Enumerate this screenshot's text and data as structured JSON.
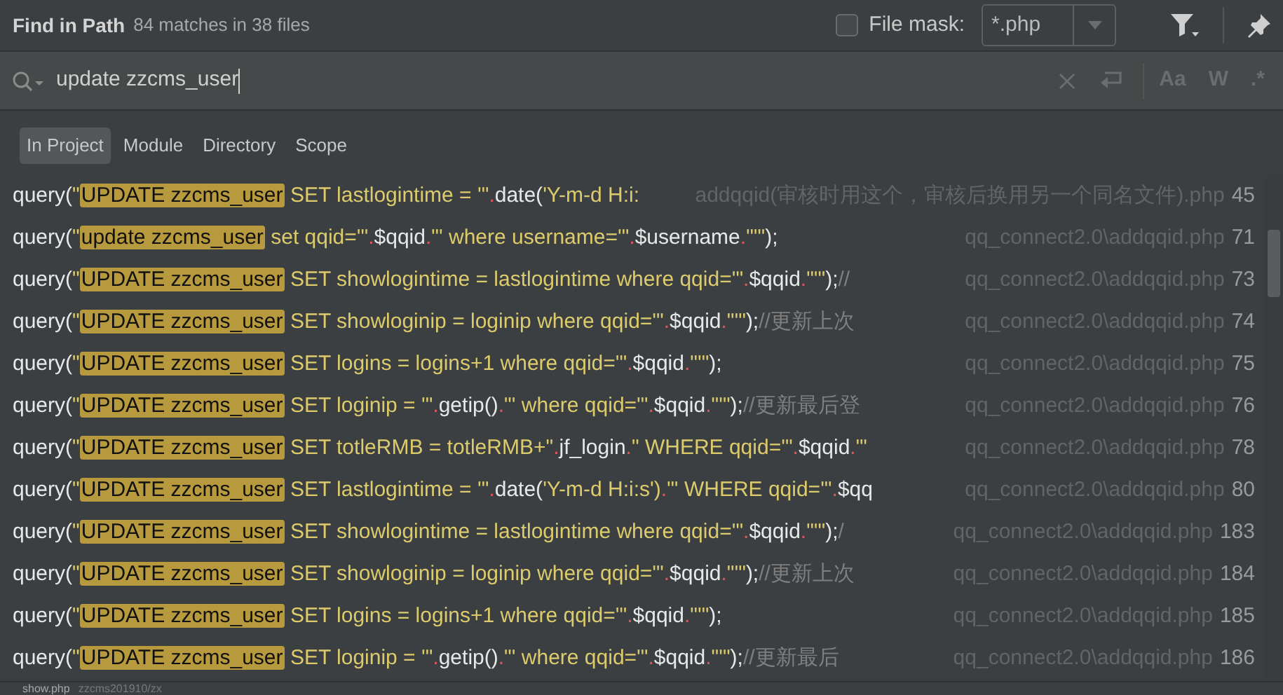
{
  "header": {
    "title": "Find in Path",
    "summary": "84 matches in 38 files",
    "file_mask": {
      "label": "File mask:",
      "checked": false,
      "value": "*.php"
    }
  },
  "search": {
    "value": "update zzcms_user",
    "toggles": [
      {
        "label": "Aa",
        "selected": false
      },
      {
        "label": "W",
        "selected": false
      },
      {
        "label": ".*",
        "selected": false
      }
    ]
  },
  "scopes": [
    {
      "label": "In Project",
      "selected": true
    },
    {
      "label": "Module",
      "selected": false
    },
    {
      "label": "Directory",
      "selected": false
    },
    {
      "label": "Scope",
      "selected": false
    }
  ],
  "results": [
    {
      "code": [
        {
          "kind": "fn",
          "text": "query("
        },
        {
          "kind": "str",
          "text": "\""
        },
        {
          "kind": "match",
          "text": "UPDATE zzcms_user"
        },
        {
          "kind": "str",
          "text": " SET lastlogintime = '\""
        },
        {
          "kind": "op",
          "text": "."
        },
        {
          "kind": "fn",
          "text": "date("
        },
        {
          "kind": "str",
          "text": "'Y-m-d H:i:"
        }
      ],
      "file": "addqqid(审核时用这个，审核后换用另一个同名文件).php",
      "line": "45"
    },
    {
      "code": [
        {
          "kind": "fn",
          "text": "query("
        },
        {
          "kind": "str",
          "text": "\""
        },
        {
          "kind": "match",
          "text": "update zzcms_user"
        },
        {
          "kind": "str",
          "text": " set qqid='\""
        },
        {
          "kind": "op",
          "text": "."
        },
        {
          "kind": "fn",
          "text": "$qqid"
        },
        {
          "kind": "op",
          "text": "."
        },
        {
          "kind": "str",
          "text": "\"' where username='\""
        },
        {
          "kind": "op",
          "text": "."
        },
        {
          "kind": "fn",
          "text": "$username"
        },
        {
          "kind": "op",
          "text": "."
        },
        {
          "kind": "str",
          "text": "\"'\""
        },
        {
          "kind": "fn",
          "text": ");"
        }
      ],
      "file": "qq_connect2.0\\addqqid.php",
      "line": "71"
    },
    {
      "code": [
        {
          "kind": "fn",
          "text": "query("
        },
        {
          "kind": "str",
          "text": "\""
        },
        {
          "kind": "match",
          "text": "UPDATE zzcms_user"
        },
        {
          "kind": "str",
          "text": " SET showlogintime = lastlogintime where qqid='\""
        },
        {
          "kind": "op",
          "text": "."
        },
        {
          "kind": "fn",
          "text": "$qqid"
        },
        {
          "kind": "op",
          "text": "."
        },
        {
          "kind": "str",
          "text": "\"'\""
        },
        {
          "kind": "fn",
          "text": ");"
        },
        {
          "kind": "comment",
          "text": "//"
        }
      ],
      "file": "qq_connect2.0\\addqqid.php",
      "line": "73"
    },
    {
      "code": [
        {
          "kind": "fn",
          "text": "query("
        },
        {
          "kind": "str",
          "text": "\""
        },
        {
          "kind": "match",
          "text": "UPDATE zzcms_user"
        },
        {
          "kind": "str",
          "text": " SET showloginip = loginip where qqid='\""
        },
        {
          "kind": "op",
          "text": "."
        },
        {
          "kind": "fn",
          "text": "$qqid"
        },
        {
          "kind": "op",
          "text": "."
        },
        {
          "kind": "str",
          "text": "\"'\""
        },
        {
          "kind": "fn",
          "text": ");"
        },
        {
          "kind": "comment",
          "text": "//更新上次"
        }
      ],
      "file": "qq_connect2.0\\addqqid.php",
      "line": "74"
    },
    {
      "code": [
        {
          "kind": "fn",
          "text": "query("
        },
        {
          "kind": "str",
          "text": "\""
        },
        {
          "kind": "match",
          "text": "UPDATE zzcms_user"
        },
        {
          "kind": "str",
          "text": " SET logins = logins+1 where qqid='\""
        },
        {
          "kind": "op",
          "text": "."
        },
        {
          "kind": "fn",
          "text": "$qqid"
        },
        {
          "kind": "op",
          "text": "."
        },
        {
          "kind": "str",
          "text": "\"'\""
        },
        {
          "kind": "fn",
          "text": ");"
        }
      ],
      "file": "qq_connect2.0\\addqqid.php",
      "line": "75"
    },
    {
      "code": [
        {
          "kind": "fn",
          "text": "query("
        },
        {
          "kind": "str",
          "text": "\""
        },
        {
          "kind": "match",
          "text": "UPDATE zzcms_user"
        },
        {
          "kind": "str",
          "text": " SET loginip = '\""
        },
        {
          "kind": "op",
          "text": "."
        },
        {
          "kind": "fn",
          "text": "getip()"
        },
        {
          "kind": "op",
          "text": "."
        },
        {
          "kind": "str",
          "text": "\"' where qqid='\""
        },
        {
          "kind": "op",
          "text": "."
        },
        {
          "kind": "fn",
          "text": "$qqid"
        },
        {
          "kind": "op",
          "text": "."
        },
        {
          "kind": "str",
          "text": "\"'\""
        },
        {
          "kind": "fn",
          "text": ");"
        },
        {
          "kind": "comment",
          "text": "//更新最后登"
        }
      ],
      "file": "qq_connect2.0\\addqqid.php",
      "line": "76"
    },
    {
      "code": [
        {
          "kind": "fn",
          "text": "query("
        },
        {
          "kind": "str",
          "text": "\""
        },
        {
          "kind": "match",
          "text": "UPDATE zzcms_user"
        },
        {
          "kind": "str",
          "text": " SET totleRMB = totleRMB+\""
        },
        {
          "kind": "op",
          "text": "."
        },
        {
          "kind": "fn",
          "text": "jf_login"
        },
        {
          "kind": "op",
          "text": "."
        },
        {
          "kind": "str",
          "text": "\" WHERE qqid='\""
        },
        {
          "kind": "op",
          "text": "."
        },
        {
          "kind": "fn",
          "text": "$qqid"
        },
        {
          "kind": "op",
          "text": "."
        },
        {
          "kind": "str",
          "text": "\"'"
        }
      ],
      "file": "qq_connect2.0\\addqqid.php",
      "line": "78"
    },
    {
      "code": [
        {
          "kind": "fn",
          "text": "query("
        },
        {
          "kind": "str",
          "text": "\""
        },
        {
          "kind": "match",
          "text": "UPDATE zzcms_user"
        },
        {
          "kind": "str",
          "text": " SET lastlogintime = '\""
        },
        {
          "kind": "op",
          "text": "."
        },
        {
          "kind": "fn",
          "text": "date("
        },
        {
          "kind": "str",
          "text": "'Y-m-d H:i:s')"
        },
        {
          "kind": "op",
          "text": "."
        },
        {
          "kind": "str",
          "text": "\"' WHERE qqid='\""
        },
        {
          "kind": "op",
          "text": "."
        },
        {
          "kind": "fn",
          "text": "$qq"
        }
      ],
      "file": "qq_connect2.0\\addqqid.php",
      "line": "80"
    },
    {
      "code": [
        {
          "kind": "fn",
          "text": "query("
        },
        {
          "kind": "str",
          "text": "\""
        },
        {
          "kind": "match",
          "text": "UPDATE zzcms_user"
        },
        {
          "kind": "str",
          "text": " SET showlogintime = lastlogintime where qqid='\""
        },
        {
          "kind": "op",
          "text": "."
        },
        {
          "kind": "fn",
          "text": "$qqid"
        },
        {
          "kind": "op",
          "text": "."
        },
        {
          "kind": "str",
          "text": "\"'\""
        },
        {
          "kind": "fn",
          "text": ");"
        },
        {
          "kind": "comment",
          "text": "/"
        }
      ],
      "file": "qq_connect2.0\\addqqid.php",
      "line": "183"
    },
    {
      "code": [
        {
          "kind": "fn",
          "text": "query("
        },
        {
          "kind": "str",
          "text": "\""
        },
        {
          "kind": "match",
          "text": "UPDATE zzcms_user"
        },
        {
          "kind": "str",
          "text": " SET showloginip = loginip where qqid='\""
        },
        {
          "kind": "op",
          "text": "."
        },
        {
          "kind": "fn",
          "text": "$qqid"
        },
        {
          "kind": "op",
          "text": "."
        },
        {
          "kind": "str",
          "text": "\"'\""
        },
        {
          "kind": "fn",
          "text": ");"
        },
        {
          "kind": "comment",
          "text": "//更新上次"
        }
      ],
      "file": "qq_connect2.0\\addqqid.php",
      "line": "184"
    },
    {
      "code": [
        {
          "kind": "fn",
          "text": "query("
        },
        {
          "kind": "str",
          "text": "\""
        },
        {
          "kind": "match",
          "text": "UPDATE zzcms_user"
        },
        {
          "kind": "str",
          "text": " SET logins = logins+1 where qqid='\""
        },
        {
          "kind": "op",
          "text": "."
        },
        {
          "kind": "fn",
          "text": "$qqid"
        },
        {
          "kind": "op",
          "text": "."
        },
        {
          "kind": "str",
          "text": "\"'\""
        },
        {
          "kind": "fn",
          "text": ");"
        }
      ],
      "file": "qq_connect2.0\\addqqid.php",
      "line": "185"
    },
    {
      "code": [
        {
          "kind": "fn",
          "text": "query("
        },
        {
          "kind": "str",
          "text": "\""
        },
        {
          "kind": "match",
          "text": "UPDATE zzcms_user"
        },
        {
          "kind": "str",
          "text": " SET loginip = '\""
        },
        {
          "kind": "op",
          "text": "."
        },
        {
          "kind": "fn",
          "text": "getip()"
        },
        {
          "kind": "op",
          "text": "."
        },
        {
          "kind": "str",
          "text": "\"' where qqid='\""
        },
        {
          "kind": "op",
          "text": "."
        },
        {
          "kind": "fn",
          "text": "$qqid"
        },
        {
          "kind": "op",
          "text": "."
        },
        {
          "kind": "str",
          "text": "\"'\""
        },
        {
          "kind": "fn",
          "text": ");"
        },
        {
          "kind": "comment",
          "text": "//更新最后"
        }
      ],
      "file": "qq_connect2.0\\addqqid.php",
      "line": "186"
    }
  ],
  "preview": {
    "file": "show.php",
    "path": "zzcms201910/zx"
  }
}
